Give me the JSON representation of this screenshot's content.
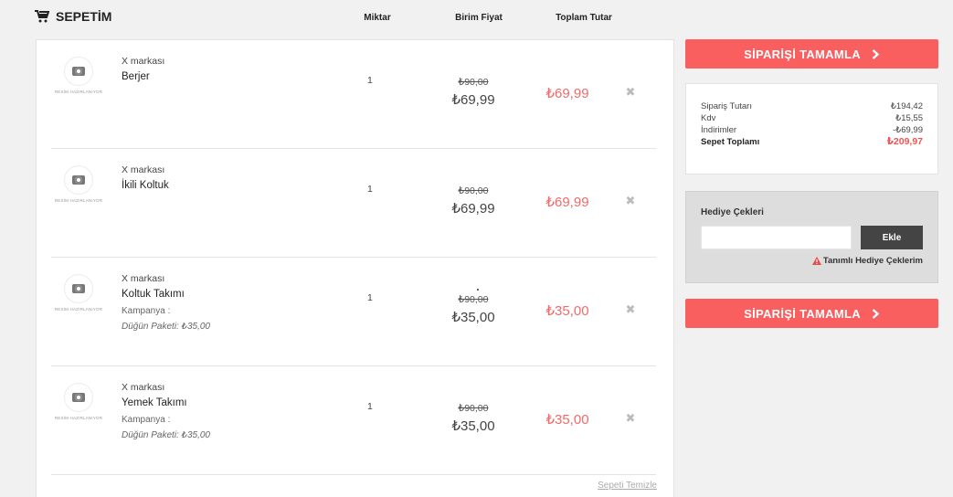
{
  "cart": {
    "title": "SEPETİM",
    "icon": "cart-icon",
    "columns": {
      "quantity": "Miktar",
      "unit_price": "Birim Fiyat",
      "total": "Toplam Tutar"
    },
    "image_placeholder": "RESİM HAZIRLANIYOR",
    "items": [
      {
        "brand": "X markası",
        "name": "Berjer",
        "campaign_label": "",
        "campaign_detail": "",
        "quantity": "1",
        "old_price": "₺90,00",
        "unit_price": "₺69,99",
        "total": "₺69,99"
      },
      {
        "brand": "X markası",
        "name": "İkili Koltuk",
        "campaign_label": "",
        "campaign_detail": "",
        "quantity": "1",
        "old_price": "₺90,00",
        "unit_price": "₺69,99",
        "total": "₺69,99"
      },
      {
        "brand": "X markası",
        "name": "Koltuk Takımı",
        "campaign_label": "Kampanya :",
        "campaign_detail": "Düğün Paketi: ₺35,00",
        "quantity": "1",
        "old_price": "₺90,00",
        "unit_price": "₺35,00",
        "total": "₺35,00"
      },
      {
        "brand": "X markası",
        "name": "Yemek Takımı",
        "campaign_label": "Kampanya :",
        "campaign_detail": "Düğün Paketi: ₺35,00",
        "quantity": "1",
        "old_price": "₺90,00",
        "unit_price": "₺35,00",
        "total": "₺35,00"
      }
    ],
    "clear_label": "Sepeti Temizle"
  },
  "checkout": {
    "button_label": "SİPARİŞİ TAMAMLA",
    "button_icon": "chevron-right-icon",
    "color": "#f95f5f"
  },
  "summary": {
    "order_total_label": "Sipariş Tutarı",
    "order_total": "₺194,42",
    "vat_label": "Kdv",
    "vat": "₺15,55",
    "discounts_label": "İndirimler",
    "discounts": "-₺69,99",
    "cart_total_label": "Sepet Toplamı",
    "cart_total": "₺209,97"
  },
  "gift": {
    "title": "Hediye Çekleri",
    "input_value": "",
    "add_label": "Ekle",
    "link_label": "Tanımlı Hediye Çeklerim",
    "link_icon": "warning-icon"
  }
}
